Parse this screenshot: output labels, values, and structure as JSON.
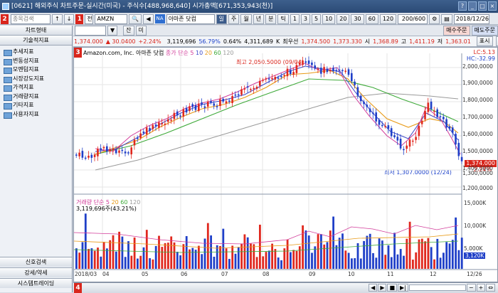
{
  "window": {
    "title": "[0621] 해외주식 차트주문-실시간(미국) - 주식수[488,968,640] 시가총액[671,353,943(천)]",
    "date": "2018/12/26",
    "title_buttons": [
      "?",
      "_",
      "□",
      "×"
    ]
  },
  "toolbar": {
    "search_placeholder": "종목검색",
    "mode_label": "전",
    "ticker": "AMZN",
    "na_badge": "NA",
    "company_name": "아마존 닷컴",
    "periods": [
      "일",
      "주",
      "월",
      "년",
      "분",
      "틱"
    ],
    "intervals": [
      "1",
      "3",
      "5",
      "10",
      "20",
      "30",
      "60",
      "120"
    ],
    "count": "200/600",
    "buy_label": "매수주문",
    "sell_label": "매도주문",
    "input_buttons": [
      "잔",
      "미"
    ]
  },
  "sidebar": {
    "chart_form_label": "차트형태",
    "tech_label": "기술적지표",
    "items": [
      "추세지표",
      "변동성지표",
      "모멘텀지표",
      "시장강도지표",
      "가격지표",
      "거래량지표",
      "기타지표",
      "사용자지표"
    ],
    "footer": [
      "신호검색",
      "강세/약세",
      "시스템트레이딩"
    ]
  },
  "quote": {
    "price": "1,374.000",
    "change": "▲ 30.0400",
    "change_pct": "+2.24%",
    "volume": "3,119,696",
    "vol_ratio": "56.79%",
    "turnover_ratio": "0.64%",
    "value": "4,311,689",
    "value_unit": "K",
    "ask_label": "최우선",
    "ask": "1,374.500",
    "bid": "1,373.330",
    "open_label": "시",
    "open": "1,368.89",
    "high_label": "고",
    "high": "1,411.19",
    "low_label": "저",
    "low": "1,363.01",
    "display_label": "표시",
    "legend_label": "범례"
  },
  "badges": [
    "1",
    "2",
    "3",
    "4"
  ],
  "chart": {
    "legend_company": "Amazon.com, Inc. 아마존 닷컴",
    "legend_ma": "종가 단순",
    "ma_periods": [
      "5",
      "10",
      "20",
      "60",
      "120"
    ],
    "lc": "LC:5.13",
    "hc": "HC:-32.99",
    "high_annotation": "최고 2,050.5000 (09/04)",
    "low_annotation": "최저 1,307.0000 (12/24)",
    "current_price": "1,374.000",
    "current_pct": "2.24%",
    "y_ticks": [
      "2,000,0000",
      "1,900,0000",
      "1,800,0000",
      "1,700,0000",
      "1,600,0000",
      "1,500,0000",
      "1,400,0000",
      "1,300,0000",
      "1,200,0000"
    ],
    "vol_legend": "거래량",
    "vol_ma": "단순",
    "vol_ma_periods": [
      "5",
      "20",
      "60",
      "120"
    ],
    "vol_value": "3,119,696주(43.21%)",
    "vol_ticks": [
      "15,000K",
      "10,000K",
      "5,000K"
    ],
    "vol_current": "3,120K",
    "x_ticks": [
      "2018/03",
      "04",
      "05",
      "06",
      "07",
      "08",
      "09",
      "10",
      "11",
      "12",
      "12/26"
    ],
    "colors": {
      "up": "#e0281e",
      "down": "#1f3fc8",
      "ma5": "#d23c9a",
      "ma10": "#3a47c8",
      "ma20": "#e89a16",
      "ma60": "#3faa3a",
      "ma120": "#9a9a9a"
    }
  },
  "chart_data": {
    "type": "candlestick",
    "title": "Amazon.com, Inc. 아마존 닷컴",
    "x": [
      "2018/03",
      "04",
      "05",
      "06",
      "07",
      "08",
      "09",
      "10",
      "11",
      "12"
    ],
    "close_approx": [
      1500,
      1460,
      1600,
      1700,
      1800,
      1890,
      2000,
      1800,
      1650,
      1374
    ],
    "ylim": [
      1180,
      2100
    ],
    "volume_ylim": [
      0,
      16000
    ]
  }
}
